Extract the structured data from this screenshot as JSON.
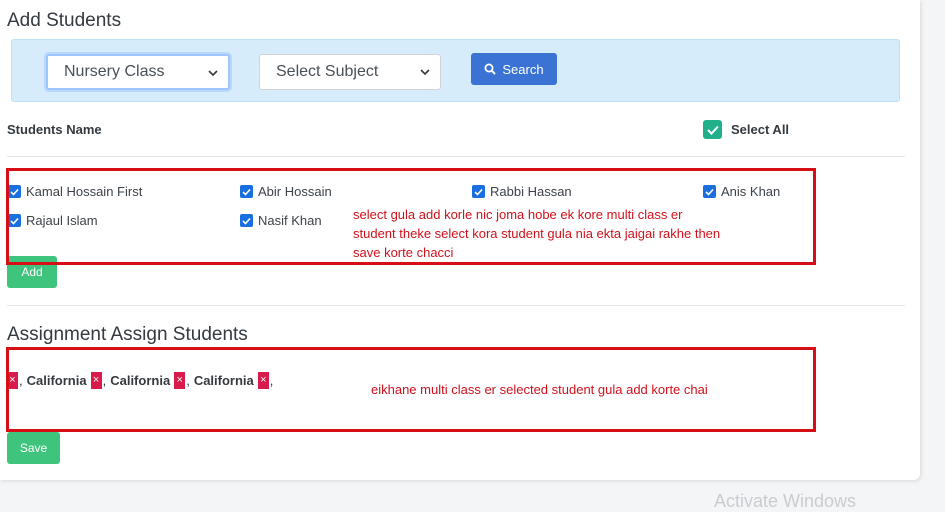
{
  "page": {
    "title": "Add Students"
  },
  "filters": {
    "class_select": "Nursery Class",
    "subject_select": "Select Subject",
    "search_label": "Search"
  },
  "students_header": {
    "name_label": "Students Name",
    "select_all_label": "Select All"
  },
  "students": [
    {
      "name": "Kamal Hossain First",
      "checked": true
    },
    {
      "name": "Abir Hossain",
      "checked": true
    },
    {
      "name": "Rabbi Hassan",
      "checked": true
    },
    {
      "name": "Anis Khan",
      "checked": true
    },
    {
      "name": "Rajaul Islam",
      "checked": true
    },
    {
      "name": "Nasif Khan",
      "checked": true
    }
  ],
  "annotation_1": [
    "select gula add korle nic joma hobe ek kore multi class er",
    "student theke select kora student gula nia ekta jaigai rakhe then",
    "save korte chacci"
  ],
  "add_button": "Add",
  "assign_section": {
    "title": "Assignment Assign Students",
    "tags": [
      {
        "remove": "×",
        "label": "California"
      },
      {
        "remove": "×",
        "label": "California"
      },
      {
        "remove": "×",
        "label": "California"
      },
      {
        "remove": "×",
        "label": ""
      }
    ],
    "separator": ",",
    "annotation": "eikhane multi class er selected student gula add korte chai"
  },
  "save_button": "Save",
  "watermark": "Activate Windows",
  "colors": {
    "primary": "#3b73d4",
    "success": "#3ec47c",
    "checkbox": "#1a6fe0",
    "select_all_checkbox": "#20b08a",
    "annotation_red": "#d60f17",
    "tag_remove": "#d81b4a",
    "filter_bar": "#d6ecfa"
  }
}
